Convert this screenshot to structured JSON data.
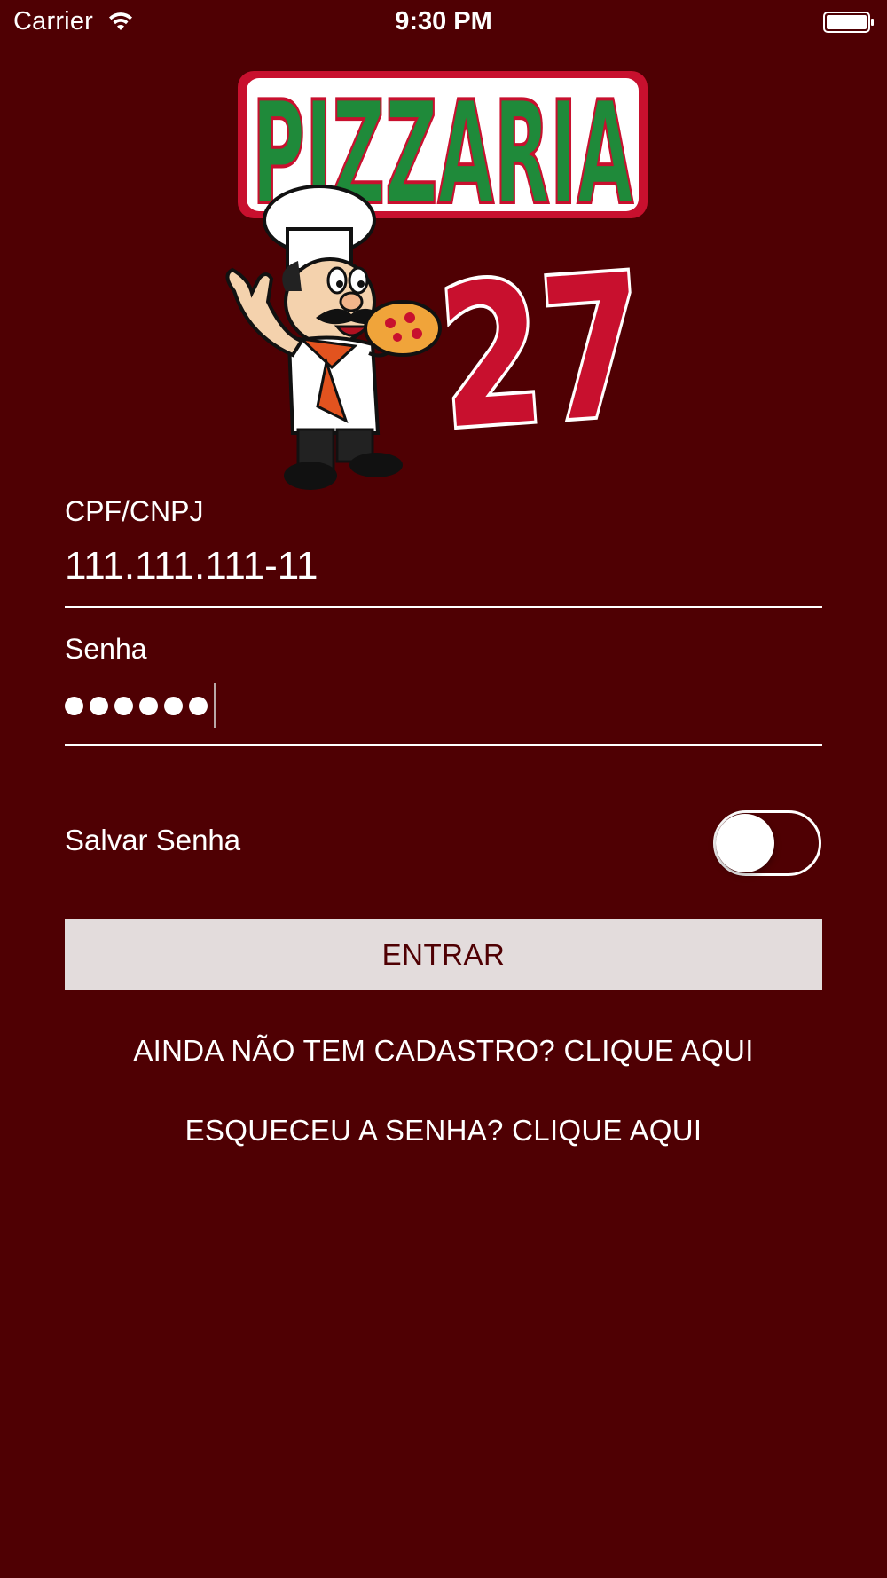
{
  "status_bar": {
    "carrier": "Carrier",
    "time": "9:30 PM",
    "wifi_icon": "wifi-icon",
    "battery_icon": "battery-icon"
  },
  "logo": {
    "line1": "PIZZARIA",
    "line2": "27",
    "mascot_icon": "chef-mascot-icon",
    "colors": {
      "green": "#1f8a3a",
      "red": "#c8102e",
      "white": "#ffffff"
    }
  },
  "form": {
    "cpf_label": "CPF/CNPJ",
    "cpf_value": "111.111.111-11",
    "password_label": "Senha",
    "password_length": 6,
    "save_password_label": "Salvar Senha",
    "save_password_on": false,
    "enter_button": "ENTRAR"
  },
  "links": {
    "register": "AINDA NÃO TEM CADASTRO? CLIQUE AQUI",
    "forgot": "ESQUECEU A SENHA? CLIQUE AQUI"
  },
  "colors": {
    "background": "#4f0003",
    "button_bg": "#e3dcdc",
    "button_text": "#4f0003",
    "text": "#ffffff"
  }
}
